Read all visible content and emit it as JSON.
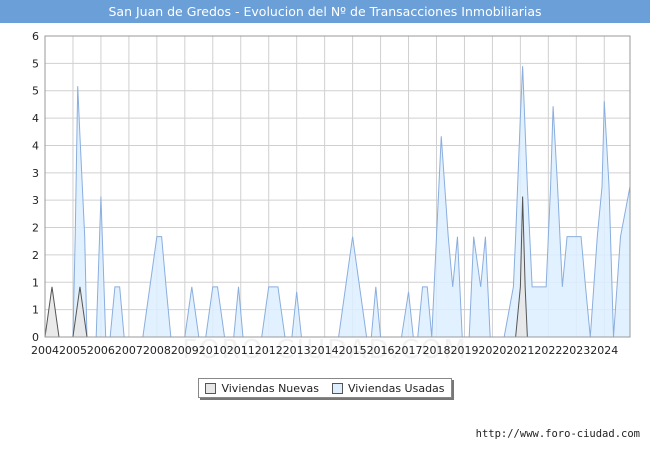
{
  "title": "San Juan de Gredos - Evolucion del Nº de Transacciones Inmobiliarias",
  "source": "http://www.foro-ciudad.com",
  "watermark": "FORO-CIUDAD.COM",
  "colors": {
    "title_bg": "#6a9fd8",
    "nuevas_fill": "#e6e6e6",
    "nuevas_line": "#555555",
    "usadas_fill": "#ddeeff",
    "usadas_line": "#8aaede",
    "grid": "#d0d0d0"
  },
  "chart_data": {
    "type": "area",
    "title": "San Juan de Gredos - Evolucion del Nº de Transacciones Inmobiliarias",
    "xlabel": "",
    "ylabel": "",
    "xlim": [
      2004,
      2024.92
    ],
    "ylim": [
      0,
      6
    ],
    "y_ticks": [
      0,
      1,
      1,
      2,
      2,
      3,
      3,
      4,
      4,
      5,
      5,
      6
    ],
    "x_ticks": [
      "2004",
      "2005",
      "2006",
      "2007",
      "2008",
      "2009",
      "2010",
      "2011",
      "2012",
      "2013",
      "2014",
      "2015",
      "2016",
      "2017",
      "2018",
      "2019",
      "2020",
      "2021",
      "2022",
      "2023",
      "2024"
    ],
    "grid": true,
    "legend_position": "bottom",
    "series": [
      {
        "name": "Viviendas Nuevas",
        "points": [
          [
            2004.0,
            0
          ],
          [
            2004.25,
            1
          ],
          [
            2004.5,
            0
          ],
          [
            2005.0,
            0
          ],
          [
            2005.25,
            1
          ],
          [
            2005.5,
            0
          ],
          [
            2020.83,
            0
          ],
          [
            2021.0,
            1
          ],
          [
            2021.08,
            2.8
          ],
          [
            2021.17,
            1
          ],
          [
            2021.25,
            0
          ]
        ]
      },
      {
        "name": "Viviendas Usadas",
        "points": [
          [
            2004.0,
            0
          ],
          [
            2005.0,
            0
          ],
          [
            2005.08,
            2
          ],
          [
            2005.17,
            5
          ],
          [
            2005.25,
            4
          ],
          [
            2005.42,
            2
          ],
          [
            2005.5,
            0
          ],
          [
            2005.83,
            0
          ],
          [
            2006.0,
            2.8
          ],
          [
            2006.17,
            0
          ],
          [
            2006.33,
            0
          ],
          [
            2006.5,
            1
          ],
          [
            2006.67,
            1
          ],
          [
            2006.83,
            0
          ],
          [
            2007.5,
            0
          ],
          [
            2007.75,
            1
          ],
          [
            2008.0,
            2
          ],
          [
            2008.17,
            2
          ],
          [
            2008.33,
            1
          ],
          [
            2008.5,
            0
          ],
          [
            2009.0,
            0
          ],
          [
            2009.25,
            1
          ],
          [
            2009.5,
            0
          ],
          [
            2009.75,
            0
          ],
          [
            2010.0,
            1
          ],
          [
            2010.17,
            1
          ],
          [
            2010.42,
            0
          ],
          [
            2010.75,
            0
          ],
          [
            2010.92,
            1
          ],
          [
            2011.08,
            0
          ],
          [
            2011.75,
            0
          ],
          [
            2012.0,
            1
          ],
          [
            2012.33,
            1
          ],
          [
            2012.58,
            0
          ],
          [
            2012.83,
            0
          ],
          [
            2013.0,
            0.9
          ],
          [
            2013.17,
            0
          ],
          [
            2014.5,
            0
          ],
          [
            2015.0,
            2
          ],
          [
            2015.5,
            0
          ],
          [
            2015.67,
            0
          ],
          [
            2015.83,
            1
          ],
          [
            2016.0,
            0
          ],
          [
            2016.75,
            0
          ],
          [
            2017.0,
            0.9
          ],
          [
            2017.17,
            0
          ],
          [
            2017.33,
            0
          ],
          [
            2017.5,
            1
          ],
          [
            2017.67,
            1
          ],
          [
            2017.83,
            0
          ],
          [
            2018.0,
            2
          ],
          [
            2018.17,
            4
          ],
          [
            2018.42,
            2
          ],
          [
            2018.58,
            1
          ],
          [
            2018.75,
            2
          ],
          [
            2018.92,
            0
          ],
          [
            2019.17,
            0
          ],
          [
            2019.33,
            2
          ],
          [
            2019.58,
            1
          ],
          [
            2019.75,
            2
          ],
          [
            2019.92,
            0
          ],
          [
            2020.42,
            0
          ],
          [
            2020.75,
            1
          ],
          [
            2020.83,
            2
          ],
          [
            2021.0,
            4.4
          ],
          [
            2021.08,
            5.4
          ],
          [
            2021.25,
            3
          ],
          [
            2021.42,
            1
          ],
          [
            2021.75,
            1
          ],
          [
            2021.92,
            1
          ],
          [
            2022.08,
            3
          ],
          [
            2022.17,
            4.6
          ],
          [
            2022.33,
            3
          ],
          [
            2022.5,
            1
          ],
          [
            2022.67,
            2
          ],
          [
            2022.83,
            2
          ],
          [
            2023.0,
            2
          ],
          [
            2023.17,
            2
          ],
          [
            2023.33,
            1
          ],
          [
            2023.5,
            0
          ],
          [
            2023.75,
            2
          ],
          [
            2023.92,
            3
          ],
          [
            2024.0,
            4.7
          ],
          [
            2024.17,
            3
          ],
          [
            2024.33,
            0
          ],
          [
            2024.58,
            2
          ],
          [
            2024.92,
            3
          ]
        ]
      }
    ]
  }
}
